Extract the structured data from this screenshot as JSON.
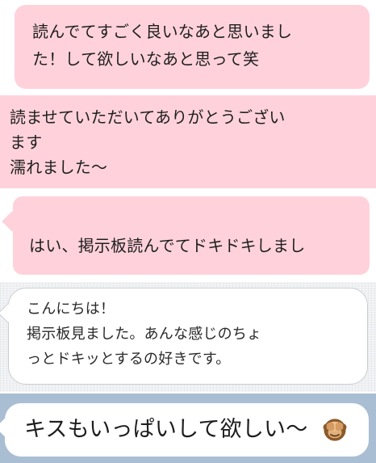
{
  "messages": {
    "msg1": {
      "text": "読んでてすごく良いなあと思いまし\nた！して欲しいなあと思って笑"
    },
    "msg2": {
      "text": "読ませていただいてありがとうござい\nます\n濡れました〜"
    },
    "msg3": {
      "text": "はい、掲示板読んでてドキドキしまし\nた",
      "icon": "pink-heart-icon"
    },
    "msg4": {
      "text": "こんにちは！\n掲示板見ました。あんな感じのちょ\nっとドキッとするの好きです。"
    },
    "msg5": {
      "text": "キスもいっぱいして欲しい〜",
      "icon": "see-no-evil-monkey-icon"
    }
  },
  "colors": {
    "pink_bubble": "#ffd2db",
    "white_bubble": "#ffffff",
    "chat_background_gray": "#eef0f2",
    "chat_background_blue": "#a9bed3",
    "text": "#1f1f1f"
  }
}
